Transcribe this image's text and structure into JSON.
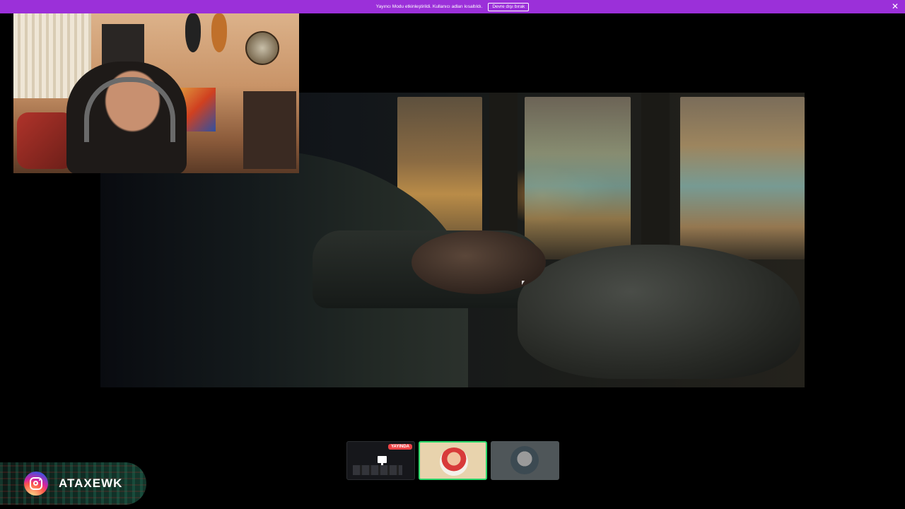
{
  "banner": {
    "message": "Yayıncı Modu etkinleştirildi. Kullanıcı adları kısaltıldı.",
    "disable_button": "Devre dışı bırak",
    "close_glyph": "✕",
    "color": "#9b30d9"
  },
  "stream": {
    "main_view": "screen-share",
    "webcam_overlay": true
  },
  "participants": [
    {
      "type": "screen-share",
      "badge": "YAYINDA",
      "badge_color": "#ed4245"
    },
    {
      "type": "avatar",
      "active": true,
      "highlight_color": "#2bd96b"
    },
    {
      "type": "avatar",
      "active": false
    }
  ],
  "overlay": {
    "instagram_handle": "ATAXEWK",
    "icon": "instagram-icon"
  }
}
